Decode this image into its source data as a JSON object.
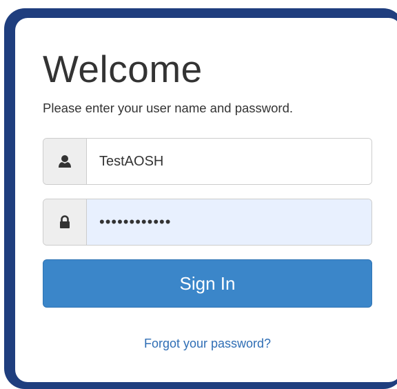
{
  "login": {
    "title": "Welcome",
    "subtitle": "Please enter your user name and password.",
    "username": {
      "value": "TestAOSH",
      "icon": "user-icon"
    },
    "password": {
      "masked_value": "••••••••••••",
      "icon": "lock-icon",
      "autofill_background": "#e8f0fe"
    },
    "sign_in_label": "Sign In",
    "forgot_password_label": "Forgot your password?"
  },
  "colors": {
    "frame_border": "#1f3e7e",
    "button_primary": "#3b86c9",
    "link": "#2f6eb5",
    "text": "#333333"
  }
}
